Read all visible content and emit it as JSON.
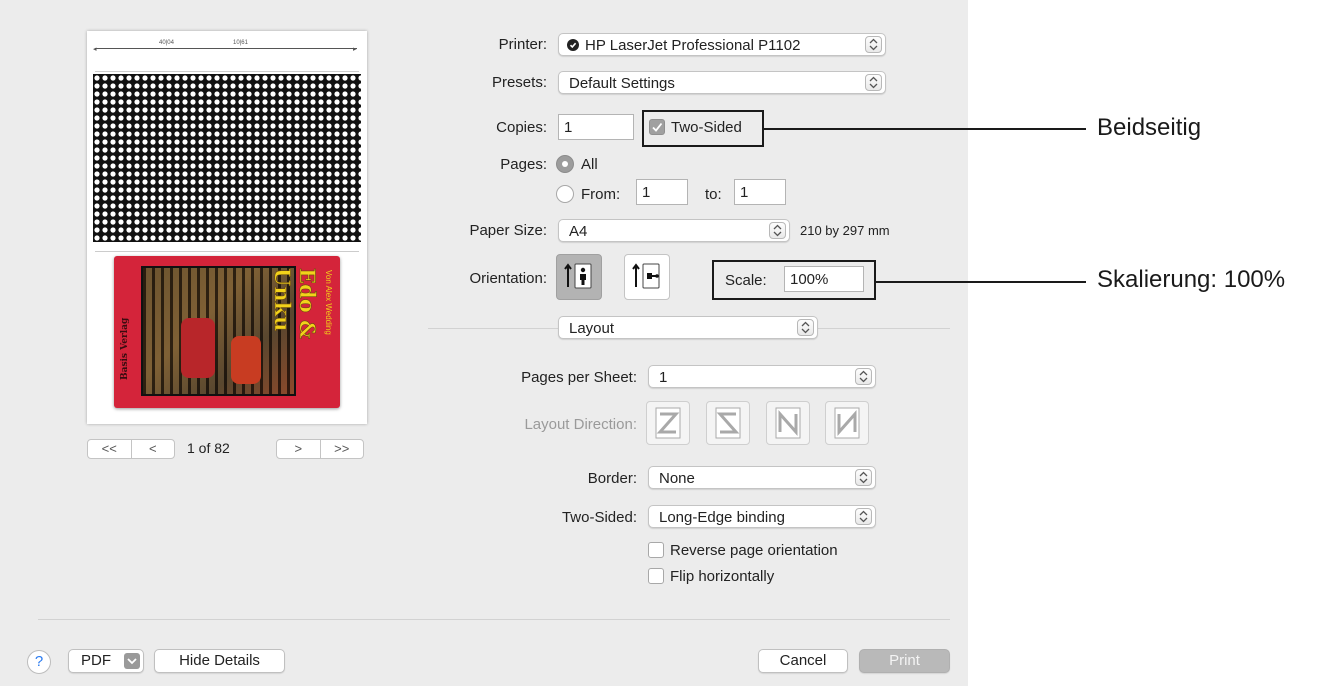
{
  "preview": {
    "page_indicator": "1 of 82",
    "ruler_left": "40|04",
    "ruler_right": "10|61",
    "book": {
      "title": "Edo & Unku",
      "subtitle": "Von Alex Wedding",
      "publisher": "Basis Verlag"
    },
    "nav": {
      "first": "<<",
      "prev": "<",
      "next": ">",
      "last": ">>"
    }
  },
  "printer": {
    "label": "Printer:",
    "value": "HP LaserJet Professional P1102"
  },
  "presets": {
    "label": "Presets:",
    "value": "Default Settings"
  },
  "copies": {
    "label": "Copies:",
    "value": "1",
    "two_sided_label": "Two-Sided",
    "two_sided_checked": true
  },
  "pages": {
    "label": "Pages:",
    "all_label": "All",
    "from_label": "From:",
    "from_value": "1",
    "to_label": "to:",
    "to_value": "1"
  },
  "paper_size": {
    "label": "Paper Size:",
    "value": "A4",
    "dims": "210 by 297 mm"
  },
  "orientation": {
    "label": "Orientation:",
    "scale_label": "Scale:",
    "scale_value": "100%"
  },
  "section": {
    "value": "Layout"
  },
  "layout": {
    "pages_per_sheet_label": "Pages per Sheet:",
    "pages_per_sheet_value": "1",
    "direction_label": "Layout Direction:",
    "border_label": "Border:",
    "border_value": "None",
    "two_sided_label": "Two-Sided:",
    "two_sided_value": "Long-Edge binding",
    "reverse_label": "Reverse page orientation",
    "flip_label": "Flip horizontally"
  },
  "footer": {
    "help": "?",
    "pdf": "PDF",
    "hide_details": "Hide Details",
    "cancel": "Cancel",
    "print": "Print"
  },
  "annotations": {
    "two_sided": "Beidseitig",
    "scale": "Skalierung: 100%"
  },
  "colors": {
    "dialog_bg": "#ececec",
    "book_cover_red": "#d4243a",
    "book_title_yellow": "#f2d21a",
    "print_disabled": "#b9b9b9"
  }
}
